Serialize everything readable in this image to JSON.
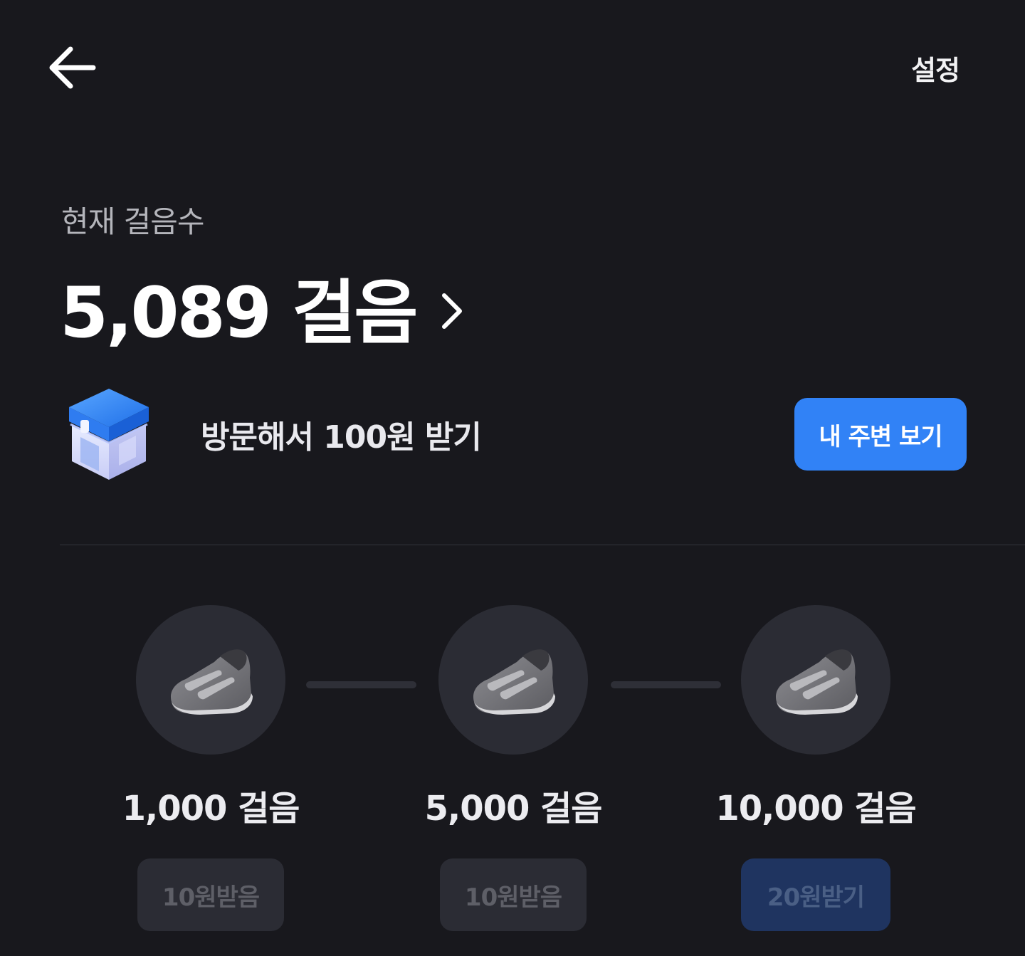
{
  "header": {
    "back_icon": "arrow-left-icon",
    "settings_label": "설정"
  },
  "steps": {
    "label": "현재 걸음수",
    "value": "5,089 걸음",
    "chevron_icon": "chevron-right-icon"
  },
  "visit": {
    "icon": "store-icon",
    "text": "방문해서 100원 받기",
    "button_label": "내 주변 보기"
  },
  "milestones": [
    {
      "icon": "shoe-icon",
      "label": "1,000 걸음",
      "reward_label": "10원받음",
      "state": "claimed"
    },
    {
      "icon": "shoe-icon",
      "label": "5,000 걸음",
      "reward_label": "10원받음",
      "state": "claimed"
    },
    {
      "icon": "shoe-icon",
      "label": "10,000 걸음",
      "reward_label": "20원받기",
      "state": "available"
    }
  ],
  "colors": {
    "background": "#18181d",
    "accent": "#3182f6",
    "card": "#2b2c34"
  }
}
